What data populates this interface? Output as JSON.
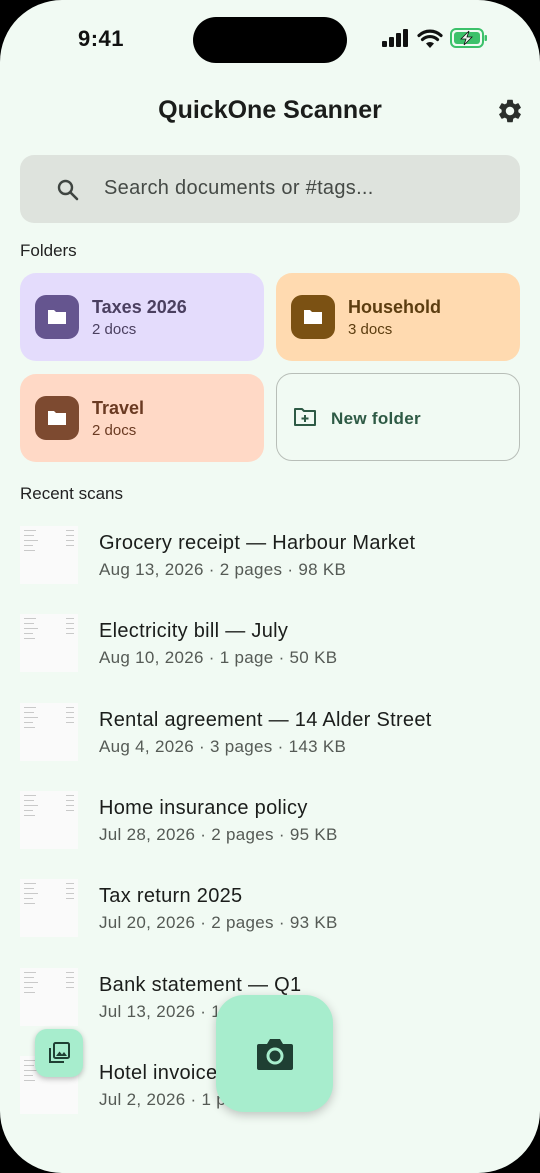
{
  "status_bar": {
    "time": "9:41"
  },
  "app": {
    "title": "QuickOne Scanner"
  },
  "search": {
    "placeholder": "Search documents or #tags..."
  },
  "folders_section": {
    "label": "Folders",
    "items": [
      {
        "name": "Taxes 2026",
        "count": "2 docs",
        "bg": "#e4dcfc",
        "badge": "#65558f",
        "text": "#4b4060"
      },
      {
        "name": "Household",
        "count": "3 docs",
        "bg": "#ffdab0",
        "badge": "#7b5113",
        "text": "#5c3d10"
      },
      {
        "name": "Travel",
        "count": "2 docs",
        "bg": "#ffd9c6",
        "badge": "#7d4a30",
        "text": "#6a3a22"
      }
    ],
    "new_folder_label": "New folder"
  },
  "recent_section": {
    "label": "Recent scans",
    "items": [
      {
        "title": "Grocery receipt — Harbour Market",
        "meta": "Aug 13, 2026 · 2 pages · 98 KB"
      },
      {
        "title": "Electricity bill — July",
        "meta": "Aug 10, 2026 · 1 page · 50 KB"
      },
      {
        "title": "Rental agreement — 14 Alder Street",
        "meta": "Aug 4, 2026 · 3 pages · 143 KB"
      },
      {
        "title": "Home insurance policy",
        "meta": "Jul 28, 2026 · 2 pages · 95 KB"
      },
      {
        "title": "Tax return 2025",
        "meta": "Jul 20, 2026 · 2 pages · 93 KB"
      },
      {
        "title": "Bank statement — Q1",
        "meta": "Jul 13, 2026 · 1 page · 40 KB"
      },
      {
        "title": "Hotel invoice",
        "meta": "Jul 2, 2026 · 1 page · 35 KB"
      }
    ]
  },
  "colors": {
    "accent": "#a7edcd",
    "background": "#f1faf3",
    "icon": "#1f3f33"
  },
  "icons": {
    "settings": "gear-icon",
    "search": "search-icon",
    "folder": "folder-icon",
    "new_folder": "create-folder-icon",
    "gallery": "image-gallery-icon",
    "camera": "camera-icon"
  }
}
